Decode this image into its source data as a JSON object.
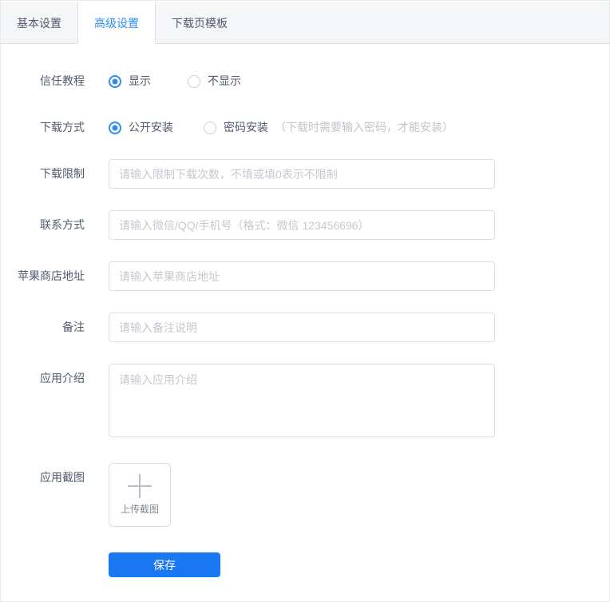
{
  "tabs": [
    {
      "label": "基本设置",
      "active": false
    },
    {
      "label": "高级设置",
      "active": true
    },
    {
      "label": "下载页模板",
      "active": false
    }
  ],
  "form": {
    "trust_tutorial": {
      "label": "信任教程",
      "options": [
        {
          "label": "显示",
          "selected": true
        },
        {
          "label": "不显示",
          "selected": false
        }
      ]
    },
    "download_method": {
      "label": "下载方式",
      "options": [
        {
          "label": "公开安装",
          "selected": true
        },
        {
          "label": "密码安装",
          "selected": false
        }
      ],
      "note": "（下载时需要输入密码，才能安装）"
    },
    "download_limit": {
      "label": "下载限制",
      "placeholder": "请输入限制下载次数，不填或填0表示不限制",
      "value": ""
    },
    "contact": {
      "label": "联系方式",
      "placeholder": "请输入微信/QQ/手机号（格式：微信 123456696）",
      "value": ""
    },
    "apple_store_url": {
      "label": "苹果商店地址",
      "placeholder": "请输入苹果商店地址",
      "value": ""
    },
    "remark": {
      "label": "备注",
      "placeholder": "请输入备注说明",
      "value": ""
    },
    "app_intro": {
      "label": "应用介绍",
      "placeholder": "请输入应用介绍",
      "value": ""
    },
    "app_screenshot": {
      "label": "应用截图",
      "upload_text": "上传截图",
      "upload_icon": "plus-icon"
    },
    "save_button": "保存"
  },
  "colors": {
    "accent": "#2d8cf0",
    "save_button": "#1a79f2",
    "tabbar_bg": "#f5f6f8",
    "border": "#dcdee2",
    "placeholder": "#c5c8ce"
  }
}
